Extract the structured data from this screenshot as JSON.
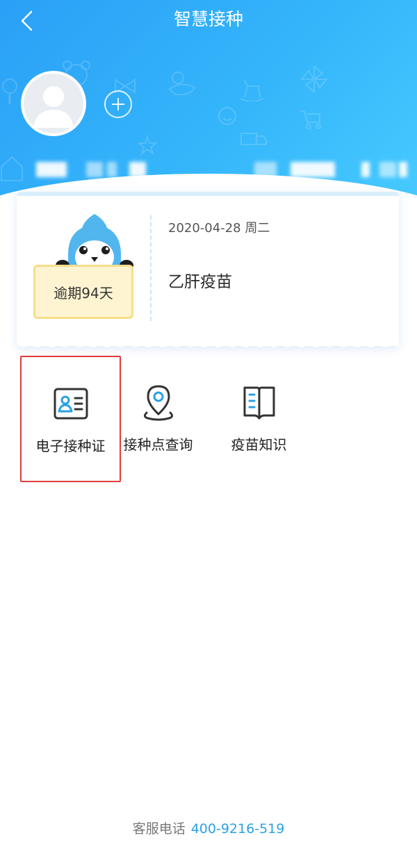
{
  "header": {
    "title": "智慧接种",
    "back_icon": "chevron-left-icon"
  },
  "profile": {
    "avatar_icon": "user-avatar-icon",
    "add_icon": "plus-circle-icon"
  },
  "reminder_card": {
    "overdue_label": "逾期94天",
    "date": "2020-04-28 周二",
    "vaccine": "乙肝疫苗",
    "mascot_icon": "penguin-mascot-icon"
  },
  "features": [
    {
      "label": "电子接种证",
      "icon": "id-card-icon"
    },
    {
      "label": "接种点查询",
      "icon": "location-pin-icon"
    },
    {
      "label": "疫苗知识",
      "icon": "book-icon"
    }
  ],
  "footer": {
    "hotline_label": "客服电话",
    "hotline_number": "400-9216-519"
  },
  "colors": {
    "header_gradient_start": "#2aa0f6",
    "header_gradient_end": "#49ccff",
    "accent": "#2aa0e6",
    "highlight_border": "#e23b3b",
    "overdue_bg": "#fff4d2"
  }
}
